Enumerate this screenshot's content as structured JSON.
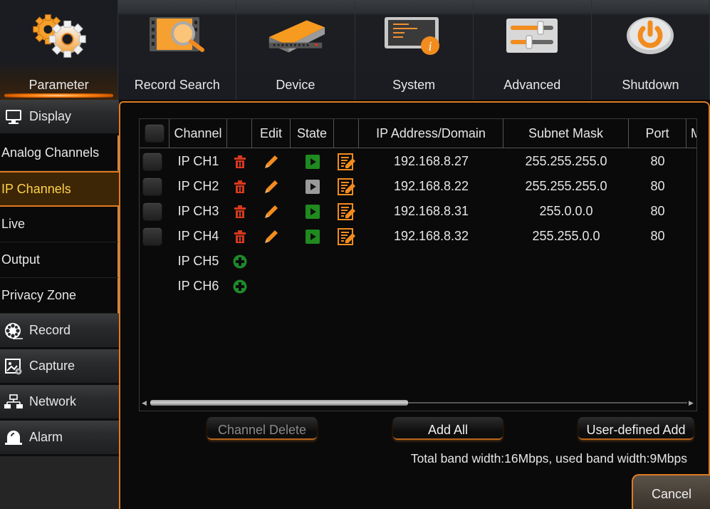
{
  "topnav": {
    "tabs": [
      {
        "label": "Parameter",
        "icon": "gears-icon",
        "active": true
      },
      {
        "label": "Record Search",
        "icon": "film-search-icon",
        "active": false
      },
      {
        "label": "Device",
        "icon": "hard-drive-icon",
        "active": false
      },
      {
        "label": "System",
        "icon": "monitor-info-icon",
        "active": false
      },
      {
        "label": "Advanced",
        "icon": "sliders-icon",
        "active": false
      },
      {
        "label": "Shutdown",
        "icon": "power-icon",
        "active": false
      }
    ]
  },
  "sidebar": {
    "items": [
      {
        "label": "Display",
        "type": "group",
        "icon": "monitor-icon"
      },
      {
        "label": "Analog Channels",
        "type": "sub"
      },
      {
        "label": "IP Channels",
        "type": "sub",
        "active": true
      },
      {
        "label": "Live",
        "type": "sub"
      },
      {
        "label": "Output",
        "type": "sub"
      },
      {
        "label": "Privacy Zone",
        "type": "sub"
      },
      {
        "label": "Record",
        "type": "group",
        "icon": "film-reel-icon"
      },
      {
        "label": "Capture",
        "type": "group",
        "icon": "image-gear-icon"
      },
      {
        "label": "Network",
        "type": "group",
        "icon": "network-icon"
      },
      {
        "label": "Alarm",
        "type": "group",
        "icon": "alarm-bell-icon"
      }
    ]
  },
  "table": {
    "columns": [
      "",
      "Channel",
      "",
      "Edit",
      "State",
      "",
      "IP Address/Domain",
      "Subnet Mask",
      "Port",
      "M"
    ],
    "rows": [
      {
        "channel": "IP CH1",
        "configured": true,
        "state": "online",
        "ip": "192.168.8.27",
        "mask": "255.255.255.0",
        "port": "80"
      },
      {
        "channel": "IP CH2",
        "configured": true,
        "state": "offline",
        "ip": "192.168.8.22",
        "mask": "255.255.255.0",
        "port": "80"
      },
      {
        "channel": "IP CH3",
        "configured": true,
        "state": "online",
        "ip": "192.168.8.31",
        "mask": "255.0.0.0",
        "port": "80"
      },
      {
        "channel": "IP CH4",
        "configured": true,
        "state": "online",
        "ip": "192.168.8.32",
        "mask": "255.255.0.0",
        "port": "80"
      },
      {
        "channel": "IP CH5",
        "configured": false
      },
      {
        "channel": "IP CH6",
        "configured": false
      }
    ],
    "scroll_fraction_visible": 0.48
  },
  "buttons": {
    "channel_delete": "Channel Delete",
    "add_all": "Add All",
    "user_defined_add": "User-defined Add",
    "cancel": "Cancel"
  },
  "bandwidth_text": "Total band width:16Mbps, used band width:9Mbps",
  "colors": {
    "accent": "#e07a20",
    "active_text": "#ffd24a",
    "state_online": "#1f8a1f",
    "state_offline": "#9a9a9a",
    "delete": "#d9381e",
    "add": "#1e8a2a"
  }
}
